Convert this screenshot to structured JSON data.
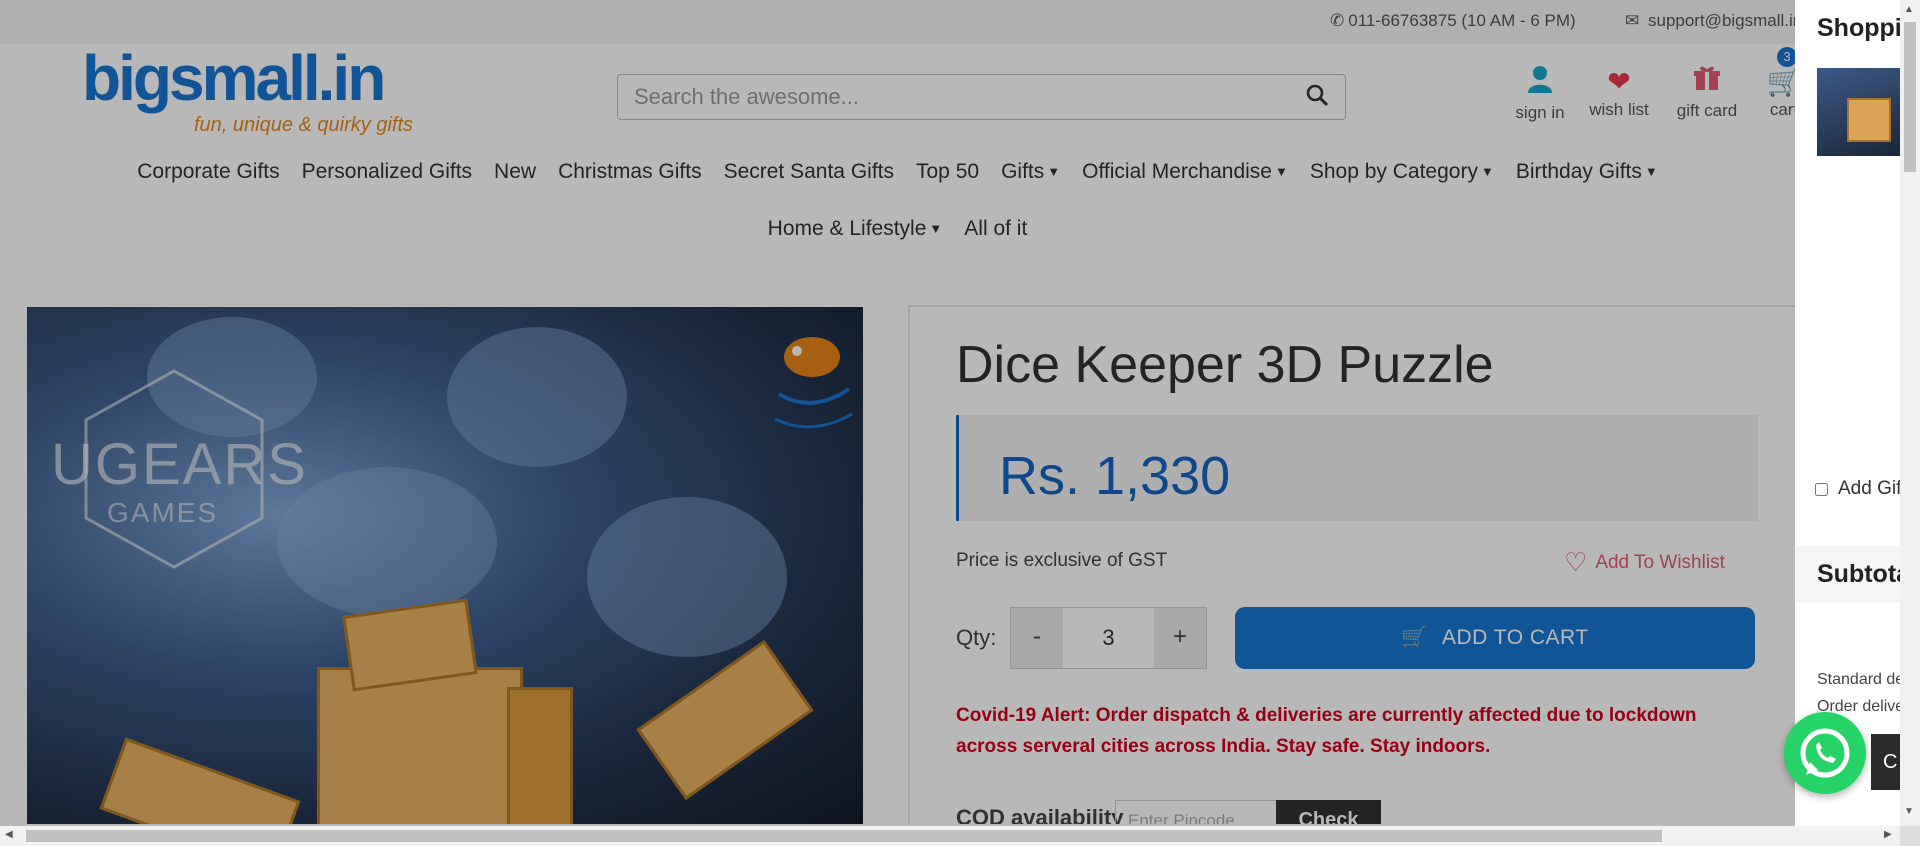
{
  "topbar": {
    "phone": "011-66763875 (10 AM - 6 PM)",
    "email": "support@bigsmall.in"
  },
  "logo": {
    "name": "bigsmall.in",
    "tagline": "fun, unique & quirky gifts"
  },
  "search": {
    "placeholder": "Search the awesome..."
  },
  "header_icons": {
    "signin": "sign in",
    "wishlist": "wish list",
    "giftcard": "gift card",
    "cart": "cart",
    "cart_count": "3"
  },
  "nav": {
    "row1": [
      "Corporate Gifts",
      "Personalized Gifts",
      "New",
      "Christmas Gifts",
      "Secret Santa Gifts",
      "Top 50",
      "Gifts",
      "Official Merchandise",
      "Shop by Category",
      "Birthday Gifts"
    ],
    "row2": [
      "Home & Lifestyle",
      "All of it"
    ]
  },
  "product_image": {
    "brand_text_1": "UGEARS",
    "brand_text_2": "GAMES"
  },
  "product": {
    "title": "Dice Keeper 3D Puzzle",
    "price": "Rs. 1,330",
    "gst_note": "Price is exclusive of GST",
    "wishlist_label": "Add To Wishlist",
    "qty_label": "Qty:",
    "qty_minus": "-",
    "qty_value": "3",
    "qty_plus": "+",
    "add_to_cart": "ADD TO CART",
    "alert": "Covid-19 Alert: Order dispatch & deliveries are currently affected due to lockdown across serveral cities across India. Stay safe. Stay indoors.",
    "cod_label": "COD availability",
    "pincode_placeholder": "Enter Pincode",
    "check_button": "Check"
  },
  "drawer": {
    "title": "Shopping Cart",
    "option_label": "Add Gift Wrap",
    "subtotal_label": "Subtotal",
    "note_line1": "Standard delivery",
    "note_line2": "Order delivery",
    "dark_btn": "C"
  },
  "colors": {
    "brand_blue": "#1976d2",
    "price_blue": "#1565c0",
    "alert_red": "#d0021b",
    "wish_pink": "#e05a72",
    "whatsapp_green": "#25d366"
  },
  "icons": [
    "phone-icon",
    "mail-icon",
    "search-icon",
    "user-icon",
    "heart-icon",
    "gift-icon",
    "cart-icon",
    "whatsapp-icon"
  ]
}
